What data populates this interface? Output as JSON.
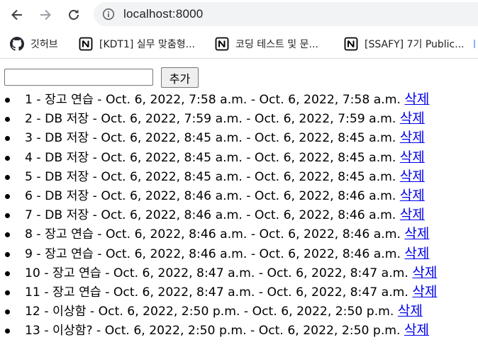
{
  "browser": {
    "url": "localhost:8000",
    "bookmarks": [
      {
        "label": "깃허브",
        "icon": "github-icon"
      },
      {
        "label": "[KDT1] 실무 맞춤형...",
        "icon": "notion-icon"
      },
      {
        "label": "코딩 테스트 및 문...",
        "icon": "notion-icon"
      },
      {
        "label": "[SSAFY] 7기 Public...",
        "icon": "notion-icon"
      }
    ]
  },
  "form": {
    "input_value": "",
    "add_label": "추가"
  },
  "todos": [
    {
      "id": "1",
      "title": "장고 연습",
      "created": "Oct. 6, 2022, 7:58 a.m.",
      "updated": "Oct. 6, 2022, 7:58 a.m.",
      "delete_label": "삭제"
    },
    {
      "id": "2",
      "title": "DB 저장",
      "created": "Oct. 6, 2022, 7:59 a.m.",
      "updated": "Oct. 6, 2022, 7:59 a.m.",
      "delete_label": "삭제"
    },
    {
      "id": "3",
      "title": "DB 저장",
      "created": "Oct. 6, 2022, 8:45 a.m.",
      "updated": "Oct. 6, 2022, 8:45 a.m.",
      "delete_label": "삭제"
    },
    {
      "id": "4",
      "title": "DB 저장",
      "created": "Oct. 6, 2022, 8:45 a.m.",
      "updated": "Oct. 6, 2022, 8:45 a.m.",
      "delete_label": "삭제"
    },
    {
      "id": "5",
      "title": "DB 저장",
      "created": "Oct. 6, 2022, 8:45 a.m.",
      "updated": "Oct. 6, 2022, 8:45 a.m.",
      "delete_label": "삭제"
    },
    {
      "id": "6",
      "title": "DB 저장",
      "created": "Oct. 6, 2022, 8:46 a.m.",
      "updated": "Oct. 6, 2022, 8:46 a.m.",
      "delete_label": "삭제"
    },
    {
      "id": "7",
      "title": "DB 저장",
      "created": "Oct. 6, 2022, 8:46 a.m.",
      "updated": "Oct. 6, 2022, 8:46 a.m.",
      "delete_label": "삭제"
    },
    {
      "id": "8",
      "title": "장고 연습",
      "created": "Oct. 6, 2022, 8:46 a.m.",
      "updated": "Oct. 6, 2022, 8:46 a.m.",
      "delete_label": "삭제"
    },
    {
      "id": "9",
      "title": "장고 연습",
      "created": "Oct. 6, 2022, 8:46 a.m.",
      "updated": "Oct. 6, 2022, 8:46 a.m.",
      "delete_label": "삭제"
    },
    {
      "id": "10",
      "title": "장고 연습",
      "created": "Oct. 6, 2022, 8:47 a.m.",
      "updated": "Oct. 6, 2022, 8:47 a.m.",
      "delete_label": "삭제"
    },
    {
      "id": "11",
      "title": "장고 연습",
      "created": "Oct. 6, 2022, 8:47 a.m.",
      "updated": "Oct. 6, 2022, 8:47 a.m.",
      "delete_label": "삭제"
    },
    {
      "id": "12",
      "title": "이상함",
      "created": "Oct. 6, 2022, 2:50 p.m.",
      "updated": "Oct. 6, 2022, 2:50 p.m.",
      "delete_label": "삭제"
    },
    {
      "id": "13",
      "title": "이상함?",
      "created": "Oct. 6, 2022, 2:50 p.m.",
      "updated": "Oct. 6, 2022, 2:50 p.m.",
      "delete_label": "삭제"
    }
  ],
  "colors": {
    "link": "#0000ee",
    "omnibox_bg": "#f1f3f4",
    "chrome_icon": "#5f6368"
  }
}
